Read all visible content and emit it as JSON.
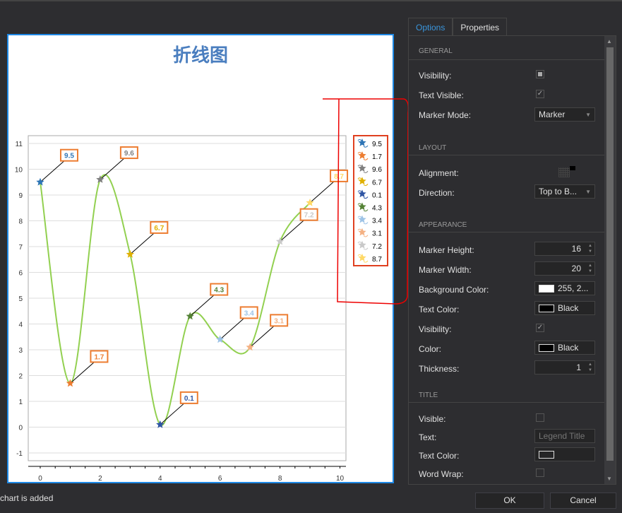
{
  "tabs": {
    "options": "Options",
    "properties": "Properties"
  },
  "sections": {
    "general": "GENERAL",
    "layout": "LAYOUT",
    "appearance": "APPEARANCE",
    "title": "TITLE"
  },
  "general": {
    "visibility": "Visibility:",
    "text_visible": "Text Visible:",
    "marker_mode": "Marker Mode:",
    "marker_mode_value": "Marker"
  },
  "layout": {
    "alignment": "Alignment:",
    "direction": "Direction:",
    "direction_value": "Top to B..."
  },
  "appearance": {
    "marker_height": "Marker Height:",
    "marker_height_value": "16",
    "marker_width": "Marker Width:",
    "marker_width_value": "20",
    "background_color": "Background Color:",
    "background_color_value": "255, 2...",
    "text_color": "Text Color:",
    "text_color_value": "Black",
    "visibility": "Visibility:",
    "color": "Color:",
    "color_value": "Black",
    "thickness": "Thickness:",
    "thickness_value": "1"
  },
  "title": {
    "visible": "Visible:",
    "text": "Text:",
    "text_placeholder": "Legend Title",
    "text_color": "Text Color:",
    "word_wrap": "Word Wrap:"
  },
  "status": "chart is added",
  "buttons": {
    "ok": "OK",
    "cancel": "Cancel"
  },
  "chart_data": {
    "type": "line",
    "title": "折线图",
    "x": [
      0,
      1,
      2,
      3,
      4,
      5,
      6,
      7,
      8,
      9
    ],
    "values": [
      9.5,
      1.7,
      9.6,
      6.7,
      0.1,
      4.3,
      3.4,
      3.1,
      7.2,
      8.7
    ],
    "labels": [
      "9.5",
      "1.7",
      "9.6",
      "6.7",
      "0.1",
      "4.3",
      "3.4",
      "3.1",
      "7.2",
      "8.7"
    ],
    "point_colors": [
      "#2e75b6",
      "#ed7d31",
      "#7f7f7f",
      "#e0b000",
      "#2f55a4",
      "#548235",
      "#9dc3e6",
      "#f4b183",
      "#c9c9c9",
      "#ffd966"
    ],
    "line_color": "#92d050",
    "xlim": [
      -0.4,
      10.2
    ],
    "ylim": [
      -1.3,
      11.3
    ],
    "xticks": [
      0,
      2,
      4,
      6,
      8,
      10
    ],
    "yticks": [
      -1,
      0,
      1,
      2,
      3,
      4,
      5,
      6,
      7,
      8,
      9,
      10,
      11
    ],
    "legend": [
      "9.5",
      "1.7",
      "9.6",
      "6.7",
      "0.1",
      "4.3",
      "3.4",
      "3.1",
      "7.2",
      "8.7"
    ],
    "legend_placement": "right",
    "grid": true
  }
}
